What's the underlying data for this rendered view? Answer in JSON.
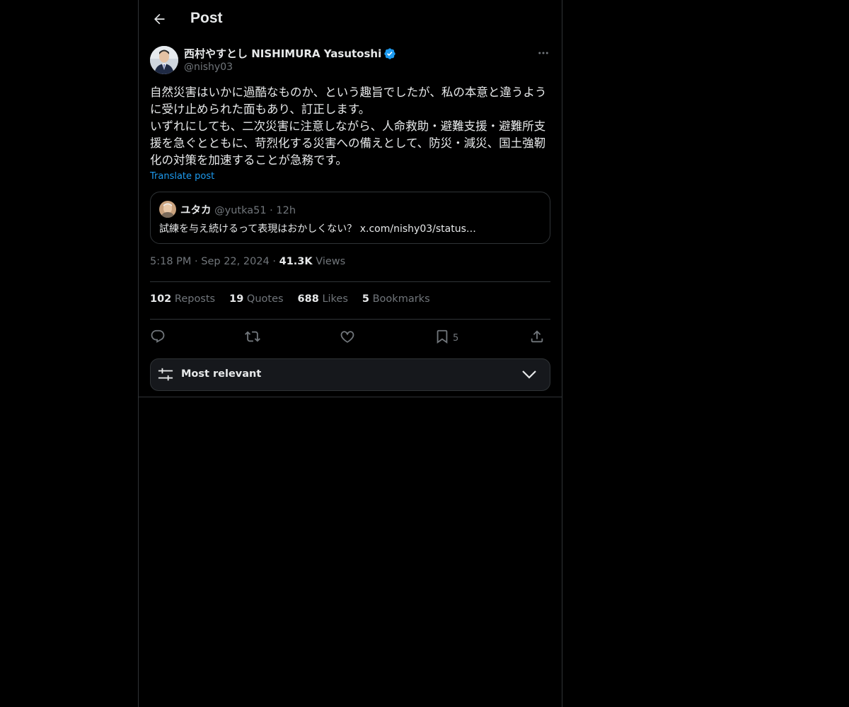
{
  "header": {
    "title": "Post",
    "back_icon": "arrow-left-icon"
  },
  "post": {
    "author_name": "西村やすとし NISHIMURA Yasutoshi",
    "author_handle": "@nishy03",
    "verified": true,
    "text_lines": [
      "自然災害はいかに過酷なものか、という趣旨でしたが、私の本意と違うように受け止められた面もあり、訂正します。",
      "いずれにしても、二次災害に注意しながら、人命救助・避難支援・避難所支援を急ぐとともに、苛烈化する災害への備えとして、防災・減災、国土強靭化の対策を加速することが急務です。"
    ],
    "translate_label": "Translate post",
    "quote": {
      "name": "ユタカ",
      "handle": "@yutka51",
      "separator": "·",
      "time": "12h",
      "text": "試練を与え続けるって表現はおかしくない？ x.com/nishy03/status…"
    },
    "meta": {
      "time": "5:18 PM",
      "separator": "·",
      "date": "Sep 22, 2024",
      "views_count": "41.3K",
      "views_label": "Views"
    },
    "stats": [
      {
        "num": "102",
        "label": "Reposts"
      },
      {
        "num": "19",
        "label": "Quotes"
      },
      {
        "num": "688",
        "label": "Likes"
      },
      {
        "num": "5",
        "label": "Bookmarks"
      }
    ],
    "actions": {
      "bookmark_count": "5"
    }
  },
  "sort": {
    "label": "Most relevant"
  },
  "colors": {
    "background": "#000000",
    "text": "#e7e9ea",
    "muted": "#71767b",
    "accent": "#1d9bf0",
    "border": "#2f3336"
  }
}
